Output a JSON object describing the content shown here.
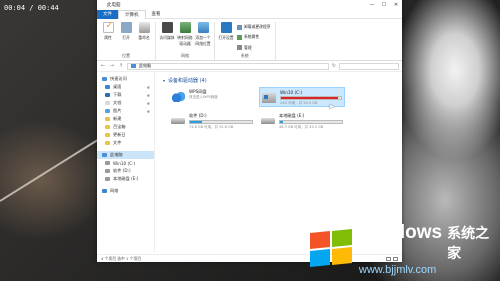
{
  "overlay": {
    "timer": "00:04 / 00:44"
  },
  "window": {
    "title": "此电脑",
    "controls": {
      "minimize": "—",
      "maximize": "☐",
      "close": "✕"
    }
  },
  "tabs": [
    {
      "label": "文件"
    },
    {
      "label": "计算机"
    },
    {
      "label": "查看"
    }
  ],
  "ribbon": {
    "groups": [
      {
        "name": "位置",
        "items": [
          {
            "label": "属性"
          },
          {
            "label": "打开"
          },
          {
            "label": "重命名"
          }
        ]
      },
      {
        "name": "网络",
        "items": [
          {
            "label": "访问媒体"
          },
          {
            "label": "映射网络驱动器"
          },
          {
            "label": "添加一个网络位置"
          }
        ]
      },
      {
        "name": "系统",
        "items": [
          {
            "label": "打开设置"
          }
        ],
        "list": [
          {
            "label": "卸载或更改程序"
          },
          {
            "label": "系统属性"
          },
          {
            "label": "管理"
          }
        ]
      }
    ]
  },
  "addressbar": {
    "back": "←",
    "forward": "→",
    "up": "↑",
    "path": "此电脑",
    "refresh": "↻",
    "search_placeholder": ""
  },
  "sidebar": {
    "items": [
      {
        "label": "快速访问"
      },
      {
        "label": "桌面"
      },
      {
        "label": "下载"
      },
      {
        "label": "文档"
      },
      {
        "label": "图片"
      },
      {
        "label": "新建"
      },
      {
        "label": "百宝箱"
      },
      {
        "label": "更新日"
      },
      {
        "label": "文件"
      },
      {
        "label": "此电脑"
      },
      {
        "label": "Win10 (C:)"
      },
      {
        "label": "软件 (D:)"
      },
      {
        "label": "本地磁盘 (E:)"
      },
      {
        "label": "网络"
      }
    ]
  },
  "main": {
    "section_title": "设备和驱动器 (4)",
    "drives": [
      {
        "name": "WPS网盘",
        "sub": "双击进入WPS网盘",
        "type": "cloud"
      },
      {
        "name": "Win10 (C:)",
        "sub": "24G 可用，共 50.0 GB",
        "fill": 0.95,
        "warn": true
      },
      {
        "name": "软件 (D:)",
        "sub": "74.8 GB 可用，共 91.6 GB",
        "fill": 0.2,
        "warn": false
      },
      {
        "name": "本地磁盘 (E:)",
        "sub": "48.3 GB 可用，共 49.2 GB",
        "fill": 0.05,
        "warn": false
      }
    ]
  },
  "statusbar": {
    "text": "4 个项目   选中 1 个项目"
  },
  "brand": {
    "name": "Windows",
    "cn": "系统之家",
    "url": "www.bjjmlv.com"
  },
  "colors": {
    "accent": "#1a6fc4",
    "bar": "#26a0da",
    "bar_warn": "#da2626"
  }
}
